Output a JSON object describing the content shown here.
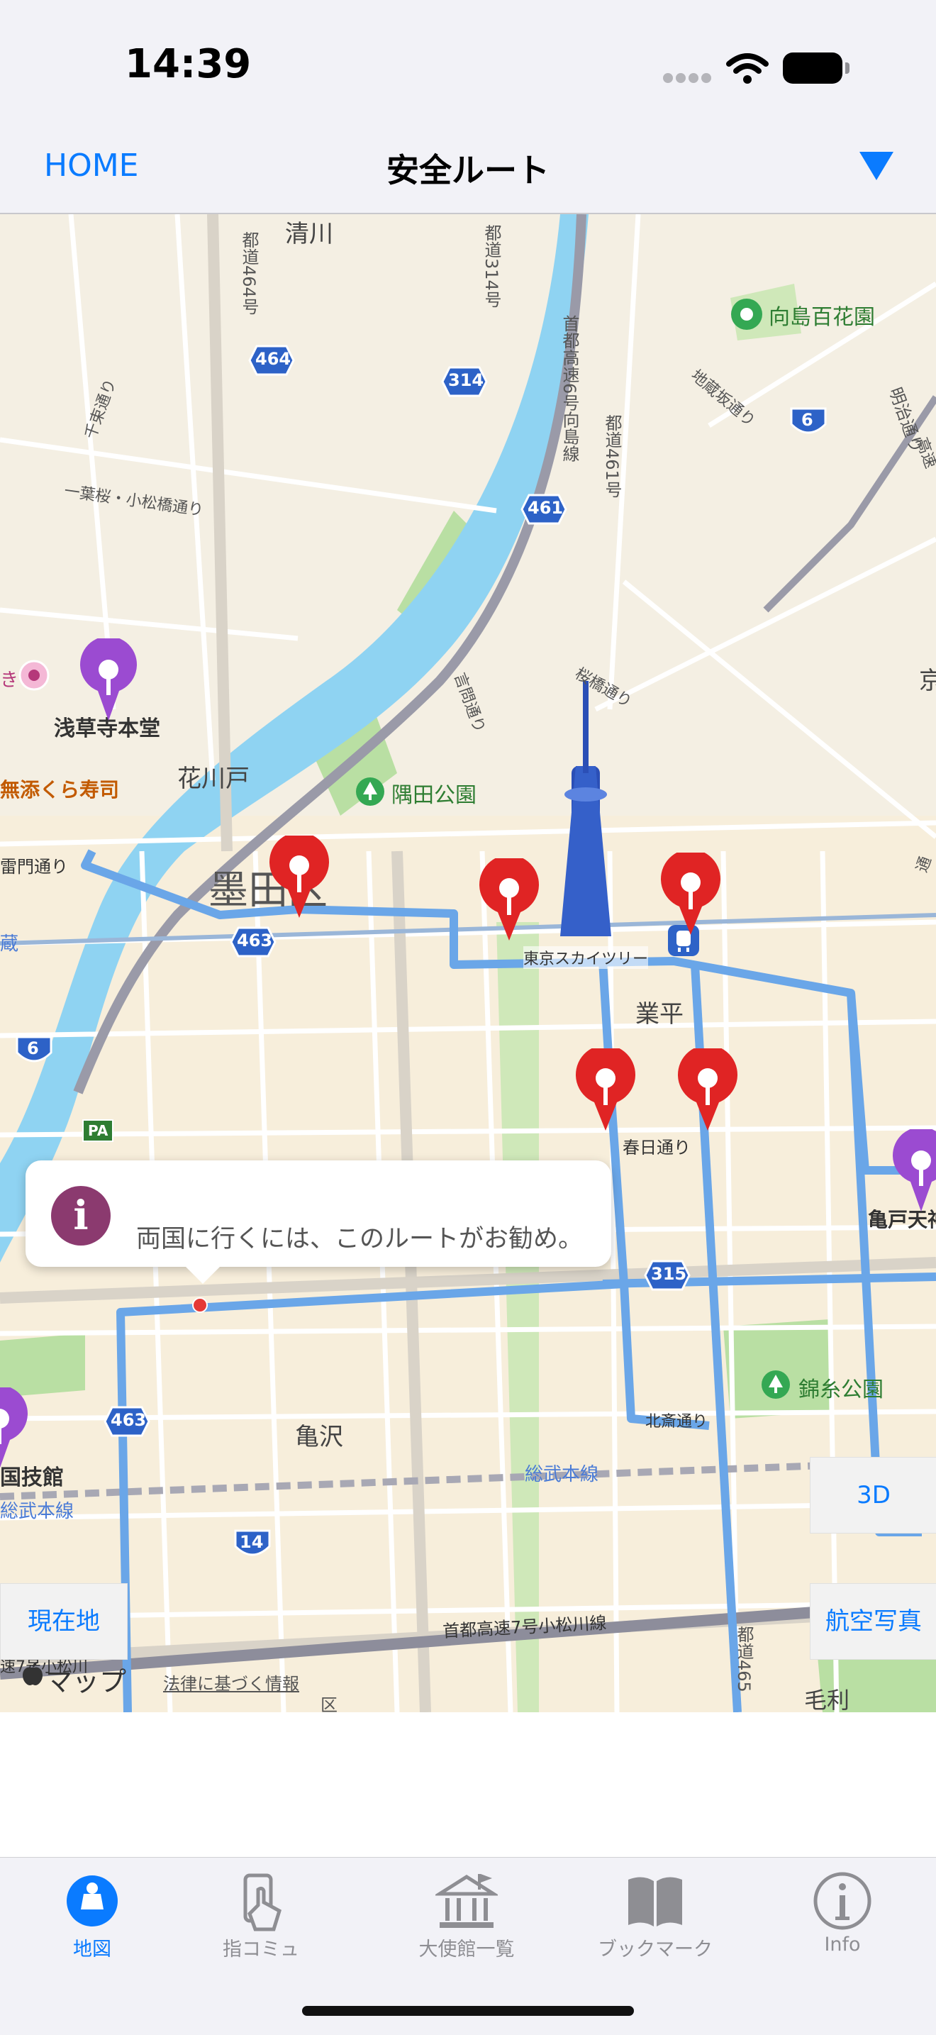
{
  "status_bar": {
    "time": "14:39"
  },
  "nav": {
    "home_label": "HOME",
    "title": "安全ルート",
    "dropdown_icon": "triangle-down-icon"
  },
  "map": {
    "labels": {
      "kiyokawa": "清川",
      "route464_vertical": "都道464号",
      "route314_vertical": "都道314号",
      "shutoko6": "首都高速6号向島線",
      "route461_vertical": "都道461号",
      "mukojima_hyakkaen": "向島百花園",
      "jizozaka": "地蔵坂通り",
      "senzoku": "千束通り",
      "ichiyozakura": "一葉桜・小松橋通り",
      "meiji_dori": "明治通り",
      "kototoi": "言問通り",
      "sakura": "桜橋通り",
      "asakusa_honbutsu": "浅草寺本堂",
      "muten_kura": "無添くら寿司",
      "hanakawado": "花川戸",
      "sumida_park": "隅田公園",
      "kaminarimon": "雷門通り",
      "sumida": "墨田区",
      "tokyo_skytree": "東京スカイツリー",
      "gyohei": "業平",
      "kasuga": "春日通り",
      "kameido": "亀戸天神",
      "kinshi_park": "錦糸公園",
      "hokusai": "北斎通り",
      "sobu": "総武本線",
      "sobu_left": "総武本線",
      "kamezawa": "亀沢",
      "kokugikan": "国技館",
      "shutoko7": "首都高速7号小松川線",
      "mori": "毛利",
      "route465": "都道465",
      "ku": "区",
      "kyo": "京",
      "shutoko_left": "速7号小松川",
      "shield_464": "464",
      "shield_314": "314",
      "shield_461": "461",
      "shield_6_top": "6",
      "shield_6_left": "6",
      "shield_463_top": "463",
      "shield_463_bottom": "463",
      "shield_315": "315",
      "shield_14": "14",
      "pa": "PA",
      "ki": "き",
      "sai_left": "蔵",
      "east_edge": "通",
      "east_edge2": "高速"
    },
    "callout": {
      "text": "両国に行くには、このルートがお勧め。",
      "icon": "info-icon"
    },
    "buttons": {
      "threed": "3D",
      "current_location": "現在地",
      "aerial": "航空写真"
    },
    "attribution": {
      "maps": "マップ",
      "legal": "法律に基づく情報"
    }
  },
  "tabs": [
    {
      "label": "地図",
      "icon": "map-tab-icon",
      "active": true
    },
    {
      "label": "指コミュ",
      "icon": "finger-communication-icon",
      "active": false
    },
    {
      "label": "大使館一覧",
      "icon": "embassy-icon",
      "active": false
    },
    {
      "label": "ブックマーク",
      "icon": "bookmark-book-icon",
      "active": false
    },
    {
      "label": "Info",
      "icon": "info-circle-icon",
      "active": false
    }
  ],
  "colors": {
    "accent": "#0a7bff",
    "route": "#6aa6e8",
    "river": "#8fd3f2",
    "park": "#b9dfa3",
    "pin_red": "#e02424",
    "pin_purple": "#9b4bd1"
  }
}
